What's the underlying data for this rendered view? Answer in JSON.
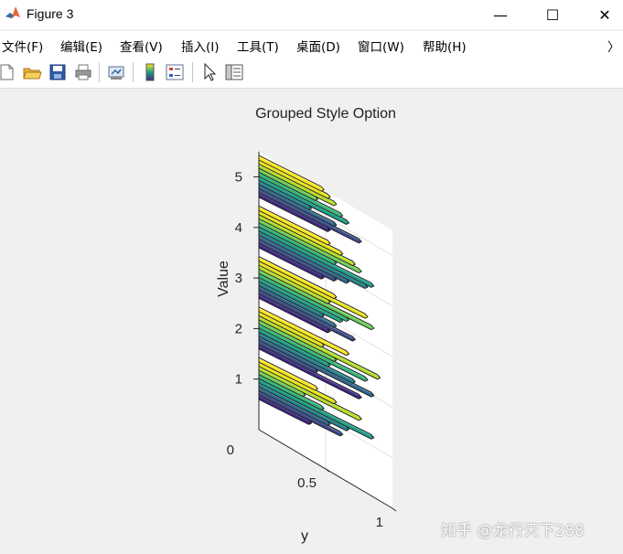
{
  "window": {
    "title": "Figure 3",
    "minimize_glyph": "—",
    "maximize_glyph": "☐",
    "close_glyph": "✕"
  },
  "menu": {
    "items": [
      "文件(F)",
      "编辑(E)",
      "查看(V)",
      "插入(I)",
      "工具(T)",
      "桌面(D)",
      "窗口(W)",
      "帮助(H)"
    ],
    "overflow_glyph": "〉"
  },
  "toolbar": {
    "icons": [
      "new-figure-icon",
      "open-file-icon",
      "save-icon",
      "print-icon",
      "link-plot-icon",
      "colorbar-icon",
      "legend-icon",
      "pointer-icon",
      "property-editor-icon"
    ]
  },
  "watermark": {
    "text": "知乎 @龙行天下288"
  },
  "colors": {
    "colormap": [
      "#3e2983",
      "#3f4a8a",
      "#31678e",
      "#26838e",
      "#1f9f88",
      "#35b779",
      "#6ece58",
      "#b5de2b",
      "#e8e419",
      "#fde725"
    ]
  },
  "chart_data": {
    "type": "bar3",
    "title": "Grouped Style Option",
    "xlabel": "",
    "ylabel": "y",
    "zlabel": "Value",
    "z_ticks": [
      "0",
      "1",
      "2",
      "3",
      "4",
      "5"
    ],
    "y_ticks": [
      "0.5",
      "1"
    ],
    "zlim": [
      0,
      5.5
    ],
    "ylim": [
      0,
      1
    ],
    "style": "grouped",
    "grid": true,
    "groups": [
      1,
      2,
      3,
      4,
      5
    ],
    "series_count": 10,
    "series_values": [
      [
        0.45,
        0.6,
        0.8,
        0.35,
        0.5,
        0.9,
        0.7,
        0.55,
        0.65,
        0.4
      ],
      [
        0.7,
        0.5,
        0.95,
        0.6,
        0.85,
        0.55,
        0.75,
        0.9,
        0.45,
        0.8
      ],
      [
        0.6,
        0.85,
        0.55,
        0.9,
        0.7,
        0.65,
        0.5,
        0.6,
        0.75,
        0.55
      ],
      [
        0.55,
        0.65,
        0.75,
        0.8,
        0.6,
        0.9,
        0.85,
        0.7,
        0.6,
        0.5
      ],
      [
        0.5,
        0.55,
        0.6,
        0.45,
        0.65,
        0.7,
        0.4,
        0.6,
        0.8,
        0.55
      ]
    ]
  }
}
